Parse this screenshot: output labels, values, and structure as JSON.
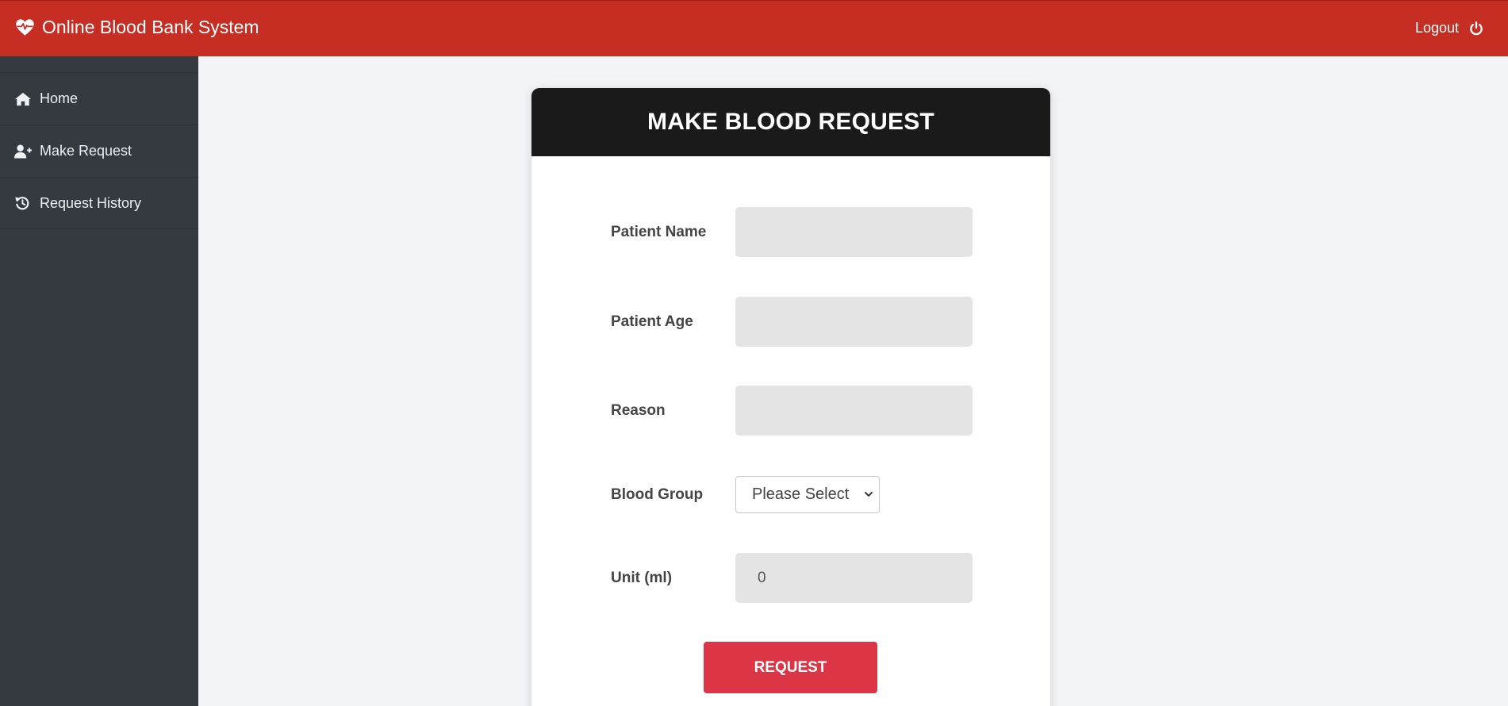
{
  "header": {
    "brand_title": "Online Blood Bank System",
    "brand_icon": "heartbeat-icon",
    "logout_label": "Logout",
    "logout_icon": "power-icon",
    "background_color": "#c62d23"
  },
  "sidebar": {
    "items": [
      {
        "label": "Home",
        "icon": "home-icon"
      },
      {
        "label": "Make Request",
        "icon": "user-plus-icon"
      },
      {
        "label": "Request History",
        "icon": "history-icon"
      }
    ]
  },
  "form": {
    "title": "MAKE BLOOD REQUEST",
    "fields": {
      "patient_name": {
        "label": "Patient Name",
        "value": ""
      },
      "patient_age": {
        "label": "Patient Age",
        "value": ""
      },
      "reason": {
        "label": "Reason",
        "value": ""
      },
      "blood_group": {
        "label": "Blood Group",
        "selected": "Please Select"
      },
      "unit": {
        "label": "Unit (ml)",
        "value": "0"
      }
    },
    "submit_label": "REQUEST",
    "submit_color": "#dc3545"
  }
}
